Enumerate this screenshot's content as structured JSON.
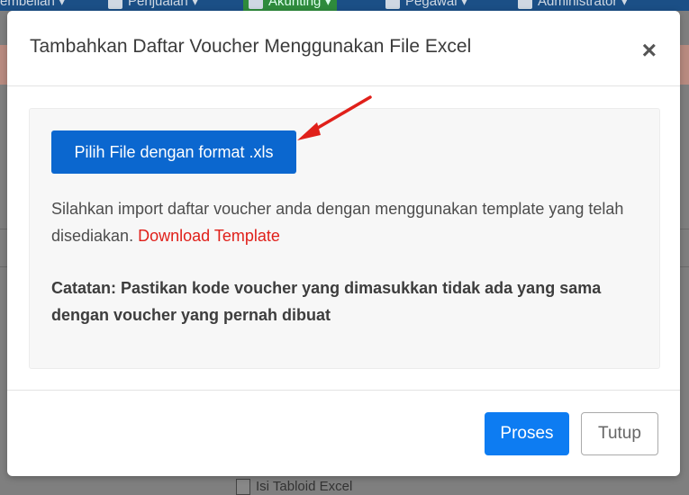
{
  "background": {
    "nav_items": [
      {
        "label": "embelian"
      },
      {
        "label": "Penjualan"
      },
      {
        "label": "Akunting"
      },
      {
        "label": "Pegawai"
      },
      {
        "label": "Administrator"
      }
    ],
    "bottom_text": "Isi Tabloid Excel"
  },
  "modal": {
    "title": "Tambahkan Daftar Voucher Menggunakan File Excel",
    "close_label": "×",
    "file_button_label": "Pilih File dengan format .xls",
    "description": "Silahkan import daftar voucher anda dengan menggunakan template yang telah disediakan.",
    "download_link_label": "Download Template",
    "note": "Catatan: Pastikan kode voucher yang dimasukkan tidak ada yang sama dengan voucher yang pernah dibuat",
    "proses_label": "Proses",
    "tutup_label": "Tutup"
  },
  "colors": {
    "primary": "#0b67cf",
    "proses": "#0d7cf2",
    "link": "#e0201a",
    "annotation_arrow": "#e0201a"
  }
}
